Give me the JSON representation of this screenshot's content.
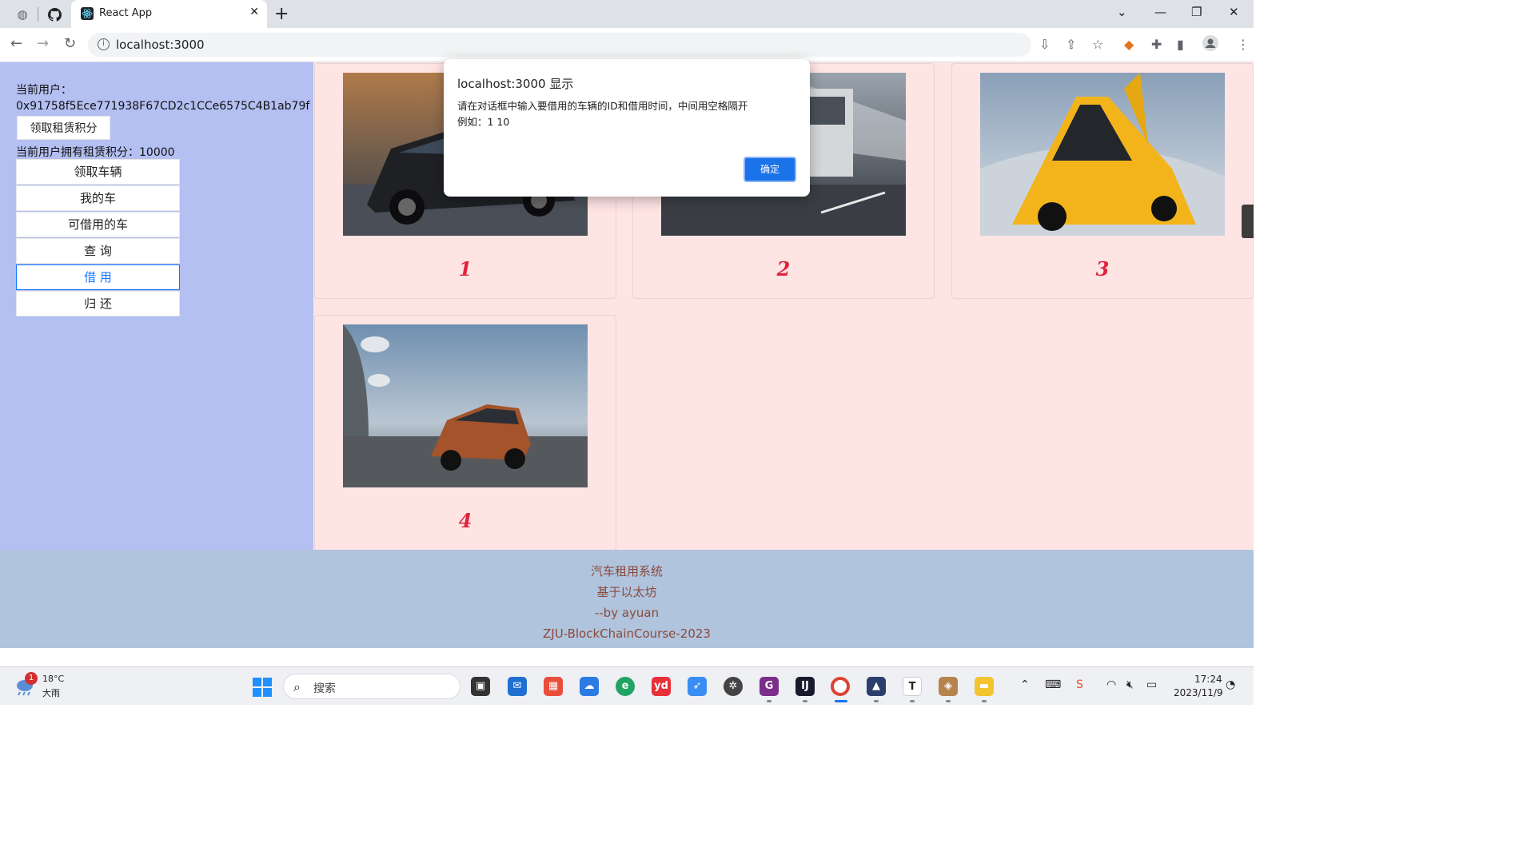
{
  "browser": {
    "tab_title": "React App",
    "url": "localhost:3000"
  },
  "sidebar": {
    "user_label": "当前用户：",
    "user_address": "0x91758f5Ece771938F67CD2c1CCe6575C4B1ab79f",
    "claim_points_label": "领取租赁积分",
    "points_text": "当前用户拥有租赁积分：10000",
    "menu": [
      "领取车辆",
      "我的车",
      "可借用的车",
      "查 询",
      "借 用",
      "归 还"
    ],
    "active_menu": "借 用"
  },
  "cars": [
    {
      "id": "1",
      "image": "dark sedan photo"
    },
    {
      "id": "2",
      "image": "silver SUV photo"
    },
    {
      "id": "3",
      "image": "yellow supercar photo"
    },
    {
      "id": "4",
      "image": "orange hatchback photo"
    }
  ],
  "footer": {
    "line1": "汽车租用系统",
    "line2": "基于以太坊",
    "line3": "--by ayuan",
    "line4": "ZJU-BlockChainCourse-2023"
  },
  "dialog": {
    "title": "localhost:3000 显示",
    "message_line1": "请在对话框中输入要借用的车辆的ID和借用时间，中间用空格隔开",
    "message_line2": "例如：1 10",
    "ok_label": "确定"
  },
  "taskbar": {
    "notification_count": "1",
    "temperature": "18°C",
    "weather": "大雨",
    "search_placeholder": "搜索",
    "time": "17:24",
    "date": "2023/11/9"
  },
  "colors": {
    "sidebar_bg": "#b4bff2",
    "content_bg": "#ffe4e4",
    "footer_bg": "#b0c4de",
    "footer_text": "#8b4a3a",
    "car_id_color": "#e0243c",
    "accent": "#1677ff"
  }
}
